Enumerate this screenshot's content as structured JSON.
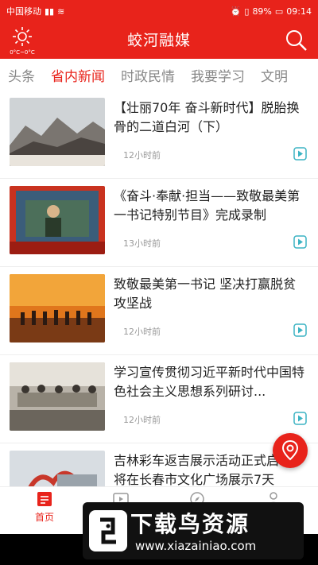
{
  "status": {
    "carrier": "中国移动",
    "battery": "89%",
    "time": "09:14"
  },
  "header": {
    "title": "蛟河融媒",
    "weather_temp": "0°C~0°C"
  },
  "tabs": [
    {
      "label": "头条"
    },
    {
      "label": "省内新闻"
    },
    {
      "label": "时政民情"
    },
    {
      "label": "我要学习"
    },
    {
      "label": "文明"
    }
  ],
  "news": [
    {
      "title": "【壮丽70年 奋斗新时代】脱胎换骨的二道白河（下）",
      "time": "12小时前"
    },
    {
      "title": "《奋斗·奉献·担当——致敬最美第一书记特别节目》完成录制",
      "time": "13小时前"
    },
    {
      "title": "致敬最美第一书记 坚决打赢脱贫攻坚战",
      "time": "12小时前"
    },
    {
      "title": "学习宣传贯彻习近平新时代中国特色社会主义思想系列研讨...",
      "time": "12小时前"
    },
    {
      "title": "吉林彩车返吉展示活动正式启动 将在长春市文化广场展示7天",
      "time": ""
    }
  ],
  "bottom_nav": [
    {
      "label": "首页"
    }
  ],
  "watermark": {
    "title": "下载鸟资源",
    "url": "www.xiazainiao.com"
  },
  "colors": {
    "brand": "#e8231b"
  }
}
